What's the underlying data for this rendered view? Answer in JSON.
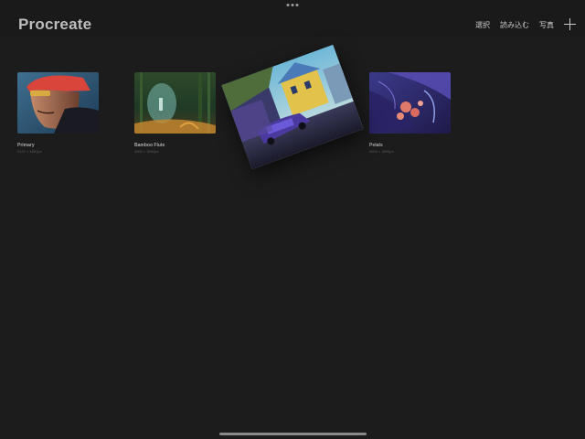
{
  "app": {
    "title": "Procreate"
  },
  "header": {
    "select_label": "選択",
    "import_label": "読み込む",
    "photos_label": "写真",
    "add_icon": "plus-icon"
  },
  "gallery": {
    "artworks": [
      {
        "title": "Primary",
        "size": "2127 × 1591px"
      },
      {
        "title": "Bamboo Flute",
        "size": "4000 × 3000px"
      },
      {
        "title": "Petals",
        "size": "4000 × 3000px"
      }
    ],
    "dragging_artwork": {
      "description_hidden": ""
    }
  },
  "colors": {
    "background": "#1c1c1c",
    "header": "#1a1a1a",
    "text_primary": "#bdbdbd",
    "text_secondary": "#5e5e5e"
  }
}
